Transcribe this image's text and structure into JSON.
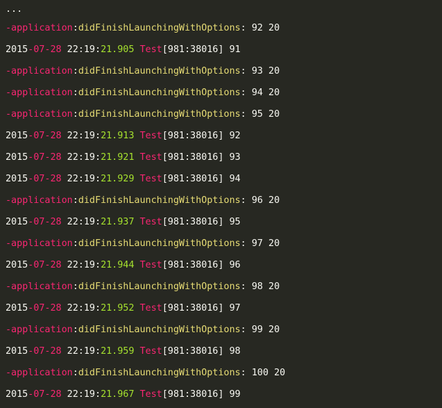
{
  "colors": {
    "background": "#272822",
    "text": "#f8f8f2",
    "pink": "#f92672",
    "yellow": "#e6db74",
    "green": "#a6e22e"
  },
  "log": {
    "ellipsis": "...",
    "lines": [
      {
        "kind": "app",
        "prefix": "-application",
        "colon1": ":",
        "method": "didFinishLaunchingWithOptions",
        "colon2": ":",
        "args": " 92 20"
      },
      {
        "kind": "time",
        "year": "2015",
        "monthday": "-07-28",
        "time": " 22:19:",
        "secs": "21.905",
        "proc": " Test",
        "pid": "[981:38016]",
        "value": " 91"
      },
      {
        "kind": "app",
        "prefix": "-application",
        "colon1": ":",
        "method": "didFinishLaunchingWithOptions",
        "colon2": ":",
        "args": " 93 20"
      },
      {
        "kind": "app",
        "prefix": "-application",
        "colon1": ":",
        "method": "didFinishLaunchingWithOptions",
        "colon2": ":",
        "args": " 94 20"
      },
      {
        "kind": "app",
        "prefix": "-application",
        "colon1": ":",
        "method": "didFinishLaunchingWithOptions",
        "colon2": ":",
        "args": " 95 20"
      },
      {
        "kind": "time",
        "year": "2015",
        "monthday": "-07-28",
        "time": " 22:19:",
        "secs": "21.913",
        "proc": " Test",
        "pid": "[981:38016]",
        "value": " 92"
      },
      {
        "kind": "time",
        "year": "2015",
        "monthday": "-07-28",
        "time": " 22:19:",
        "secs": "21.921",
        "proc": " Test",
        "pid": "[981:38016]",
        "value": " 93"
      },
      {
        "kind": "time",
        "year": "2015",
        "monthday": "-07-28",
        "time": " 22:19:",
        "secs": "21.929",
        "proc": " Test",
        "pid": "[981:38016]",
        "value": " 94"
      },
      {
        "kind": "app",
        "prefix": "-application",
        "colon1": ":",
        "method": "didFinishLaunchingWithOptions",
        "colon2": ":",
        "args": " 96 20"
      },
      {
        "kind": "time",
        "year": "2015",
        "monthday": "-07-28",
        "time": " 22:19:",
        "secs": "21.937",
        "proc": " Test",
        "pid": "[981:38016]",
        "value": " 95"
      },
      {
        "kind": "app",
        "prefix": "-application",
        "colon1": ":",
        "method": "didFinishLaunchingWithOptions",
        "colon2": ":",
        "args": " 97 20"
      },
      {
        "kind": "time",
        "year": "2015",
        "monthday": "-07-28",
        "time": " 22:19:",
        "secs": "21.944",
        "proc": " Test",
        "pid": "[981:38016]",
        "value": " 96"
      },
      {
        "kind": "app",
        "prefix": "-application",
        "colon1": ":",
        "method": "didFinishLaunchingWithOptions",
        "colon2": ":",
        "args": " 98 20"
      },
      {
        "kind": "time",
        "year": "2015",
        "monthday": "-07-28",
        "time": " 22:19:",
        "secs": "21.952",
        "proc": " Test",
        "pid": "[981:38016]",
        "value": " 97"
      },
      {
        "kind": "app",
        "prefix": "-application",
        "colon1": ":",
        "method": "didFinishLaunchingWithOptions",
        "colon2": ":",
        "args": " 99 20"
      },
      {
        "kind": "time",
        "year": "2015",
        "monthday": "-07-28",
        "time": " 22:19:",
        "secs": "21.959",
        "proc": " Test",
        "pid": "[981:38016]",
        "value": " 98"
      },
      {
        "kind": "app",
        "prefix": "-application",
        "colon1": ":",
        "method": "didFinishLaunchingWithOptions",
        "colon2": ":",
        "args": " 100 20"
      },
      {
        "kind": "time",
        "year": "2015",
        "monthday": "-07-28",
        "time": " 22:19:",
        "secs": "21.967",
        "proc": " Test",
        "pid": "[981:38016]",
        "value": " 99"
      }
    ]
  }
}
